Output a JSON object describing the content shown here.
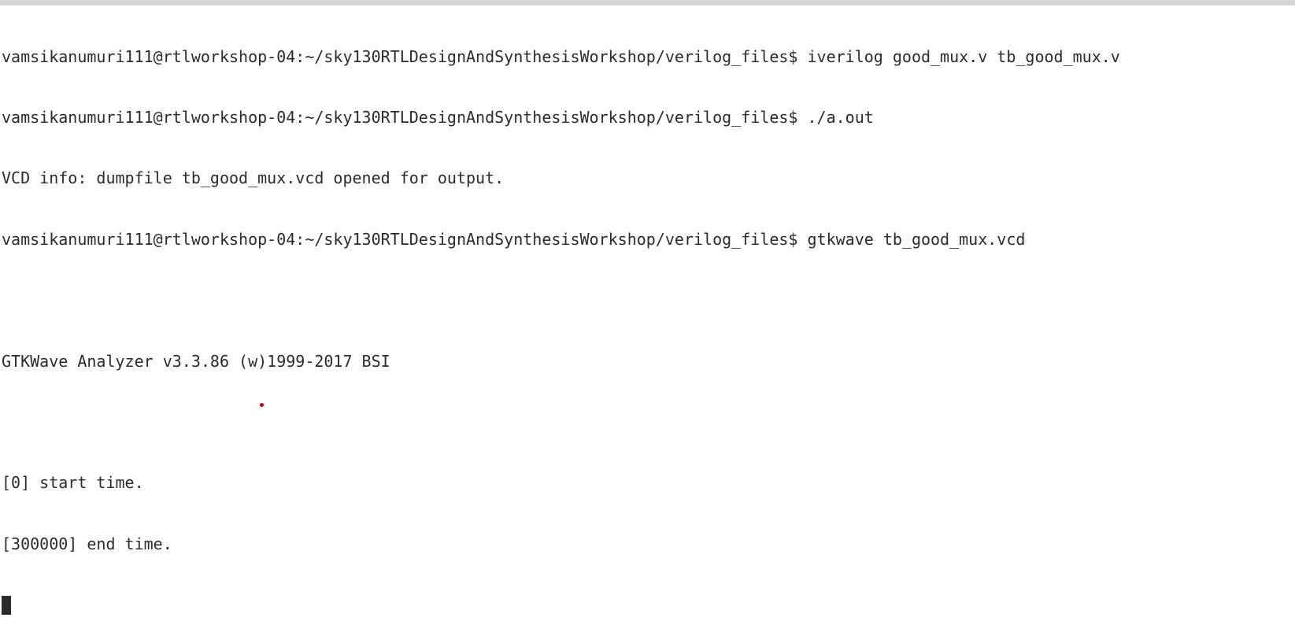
{
  "terminal": {
    "lines": [
      "vamsikanumuri111@rtlworkshop-04:~/sky130RTLDesignAndSynthesisWorkshop/verilog_files$ iverilog good_mux.v tb_good_mux.v",
      "vamsikanumuri111@rtlworkshop-04:~/sky130RTLDesignAndSynthesisWorkshop/verilog_files$ ./a.out",
      "VCD info: dumpfile tb_good_mux.vcd opened for output.",
      "vamsikanumuri111@rtlworkshop-04:~/sky130RTLDesignAndSynthesisWorkshop/verilog_files$ gtkwave tb_good_mux.vcd",
      "",
      "GTKWave Analyzer v3.3.86 (w)1999-2017 BSI",
      "",
      "[0] start time.",
      "[300000] end time."
    ]
  },
  "colors": {
    "background": "#ffffff",
    "text": "#2b2b2b",
    "top_strip": "#d6d6d6",
    "dot": "#cc0000"
  }
}
